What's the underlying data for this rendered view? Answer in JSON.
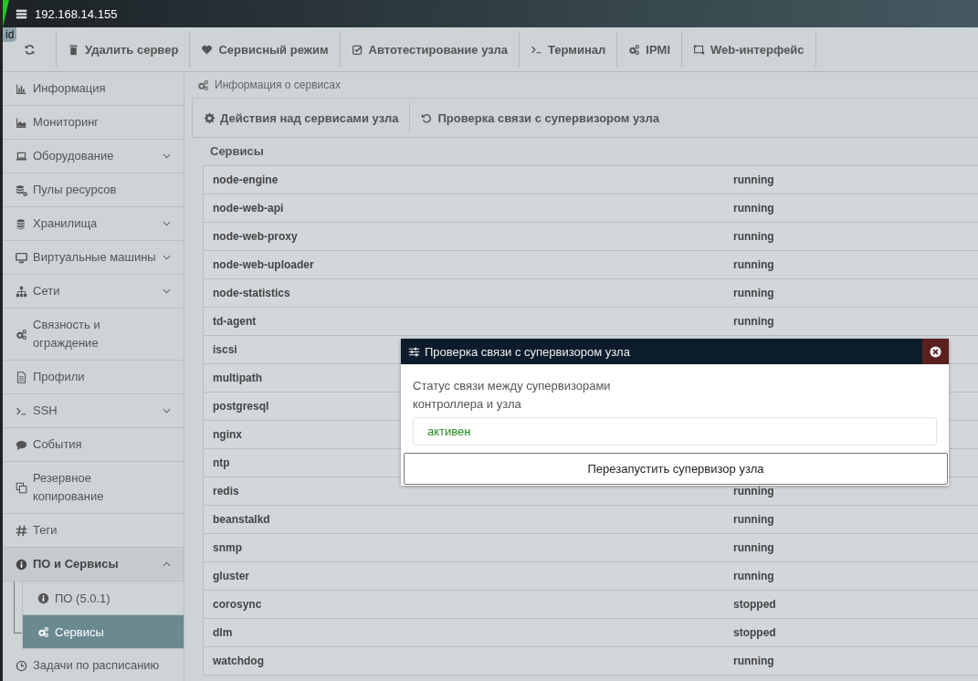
{
  "window": {
    "title": "192.168.14.155",
    "tag": "id"
  },
  "toolbar": [
    {
      "label": "Удалить сервер"
    },
    {
      "label": "Сервисный режим"
    },
    {
      "label": "Автотестирование узла"
    },
    {
      "label": "Терминал"
    },
    {
      "label": "IPMI"
    },
    {
      "label": "Web-интерфейс"
    }
  ],
  "sidebar": {
    "items": [
      {
        "label": "Информация",
        "selected": false
      },
      {
        "label": "Мониторинг",
        "selected": false
      },
      {
        "label": "Оборудование",
        "selected": false,
        "expanded": false
      },
      {
        "label": "Пулы ресурсов",
        "selected": false
      },
      {
        "label": "Хранилища",
        "selected": false,
        "expanded": false
      },
      {
        "label": "Виртуальные машины",
        "selected": false,
        "expanded": false
      },
      {
        "label": "Сети",
        "selected": false,
        "expanded": false
      },
      {
        "label": "Связность и ограждение",
        "selected": false
      },
      {
        "label": "Профили",
        "selected": false
      },
      {
        "label": "SSH",
        "selected": false,
        "expanded": false
      },
      {
        "label": "События",
        "selected": false
      },
      {
        "label": "Резервное копирование",
        "selected": false
      },
      {
        "label": "Теги",
        "selected": false
      },
      {
        "label": "ПО и Сервисы",
        "selected": false,
        "expanded": true,
        "children": [
          {
            "label": "ПО (5.0.1)",
            "selected": false
          },
          {
            "label": "Сервисы",
            "selected": true
          }
        ]
      },
      {
        "label": "Задачи по расписанию",
        "selected": false
      }
    ]
  },
  "breadcrumb": "Информация о сервисах",
  "actions": [
    "Действия над сервисами узла",
    "Проверка связи с супервизором узла"
  ],
  "services": {
    "title": "Сервисы",
    "rows": [
      {
        "name": "node-engine",
        "status": "running"
      },
      {
        "name": "node-web-api",
        "status": "running"
      },
      {
        "name": "node-web-proxy",
        "status": "running"
      },
      {
        "name": "node-web-uploader",
        "status": "running"
      },
      {
        "name": "node-statistics",
        "status": "running"
      },
      {
        "name": "td-agent",
        "status": "running"
      },
      {
        "name": "iscsi"
      },
      {
        "name": "multipath"
      },
      {
        "name": "postgresql"
      },
      {
        "name": "nginx"
      },
      {
        "name": "ntp"
      },
      {
        "name": "redis",
        "status": "running"
      },
      {
        "name": "beanstalkd",
        "status": "running"
      },
      {
        "name": "snmp",
        "status": "running"
      },
      {
        "name": "gluster",
        "status": "running"
      },
      {
        "name": "corosync",
        "status": "stopped"
      },
      {
        "name": "dlm",
        "status": "stopped"
      },
      {
        "name": "watchdog",
        "status": "running"
      }
    ]
  },
  "dialog": {
    "title": "Проверка связи с супервизором узла",
    "label": "Статус связи между супервизорами контроллера и узла",
    "value": "активен",
    "button": "Перезапустить супервизор узла"
  }
}
